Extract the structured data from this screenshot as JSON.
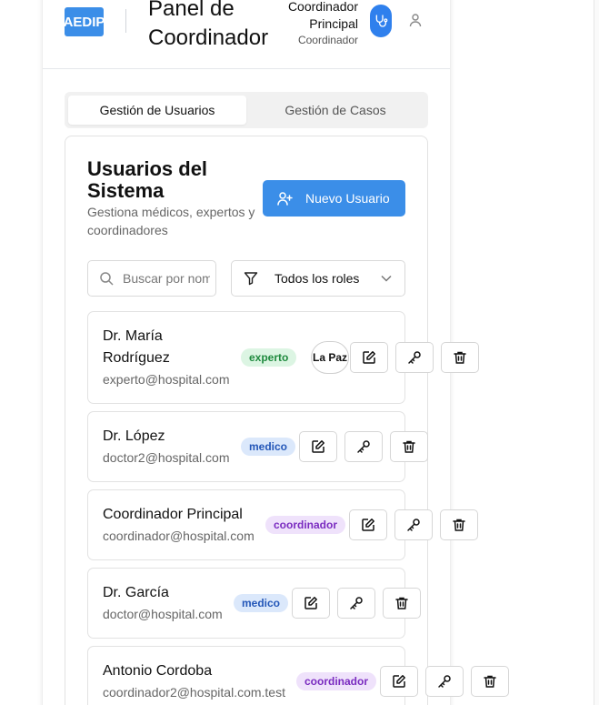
{
  "header": {
    "logo": "AEDIP",
    "title": "Panel de Coordinador",
    "user_name": "Coordinador Principal",
    "user_role": "Coordinador",
    "icons": [
      "stethoscope-icon",
      "user-icon"
    ],
    "accent": "#3b8ee8"
  },
  "tabs": [
    {
      "label": "Gestión de Usuarios",
      "active": true
    },
    {
      "label": "Gestión de Casos",
      "active": false
    }
  ],
  "users_section": {
    "title": "Usuarios del Sistema",
    "subtitle": "Gestiona médicos, expertos y coordinadores",
    "new_user_label": "Nuevo Usuario",
    "search_placeholder": "Buscar por nombre o email...",
    "role_filter": "Todos los roles"
  },
  "users": [
    {
      "name": "Dr. María Rodríguez",
      "email": "experto@hospital.com",
      "role": "experto",
      "location": "La Paz"
    },
    {
      "name": "Dr. López",
      "email": "doctor2@hospital.com",
      "role": "medico"
    },
    {
      "name": "Coordinador Principal",
      "email": "coordinador@hospital.com",
      "role": "coordinador"
    },
    {
      "name": "Dr. García",
      "email": "doctor@hospital.com",
      "role": "medico"
    },
    {
      "name": "Antonio Cordoba",
      "email": "coordinador2@hospital.com.test",
      "role": "coordinador"
    }
  ],
  "row_actions": [
    "edit-icon",
    "key-icon",
    "trash-icon"
  ],
  "role_colors": {
    "experto": "#1f8a3e",
    "medico": "#2457b8",
    "coordinador": "#7a2bc0"
  }
}
